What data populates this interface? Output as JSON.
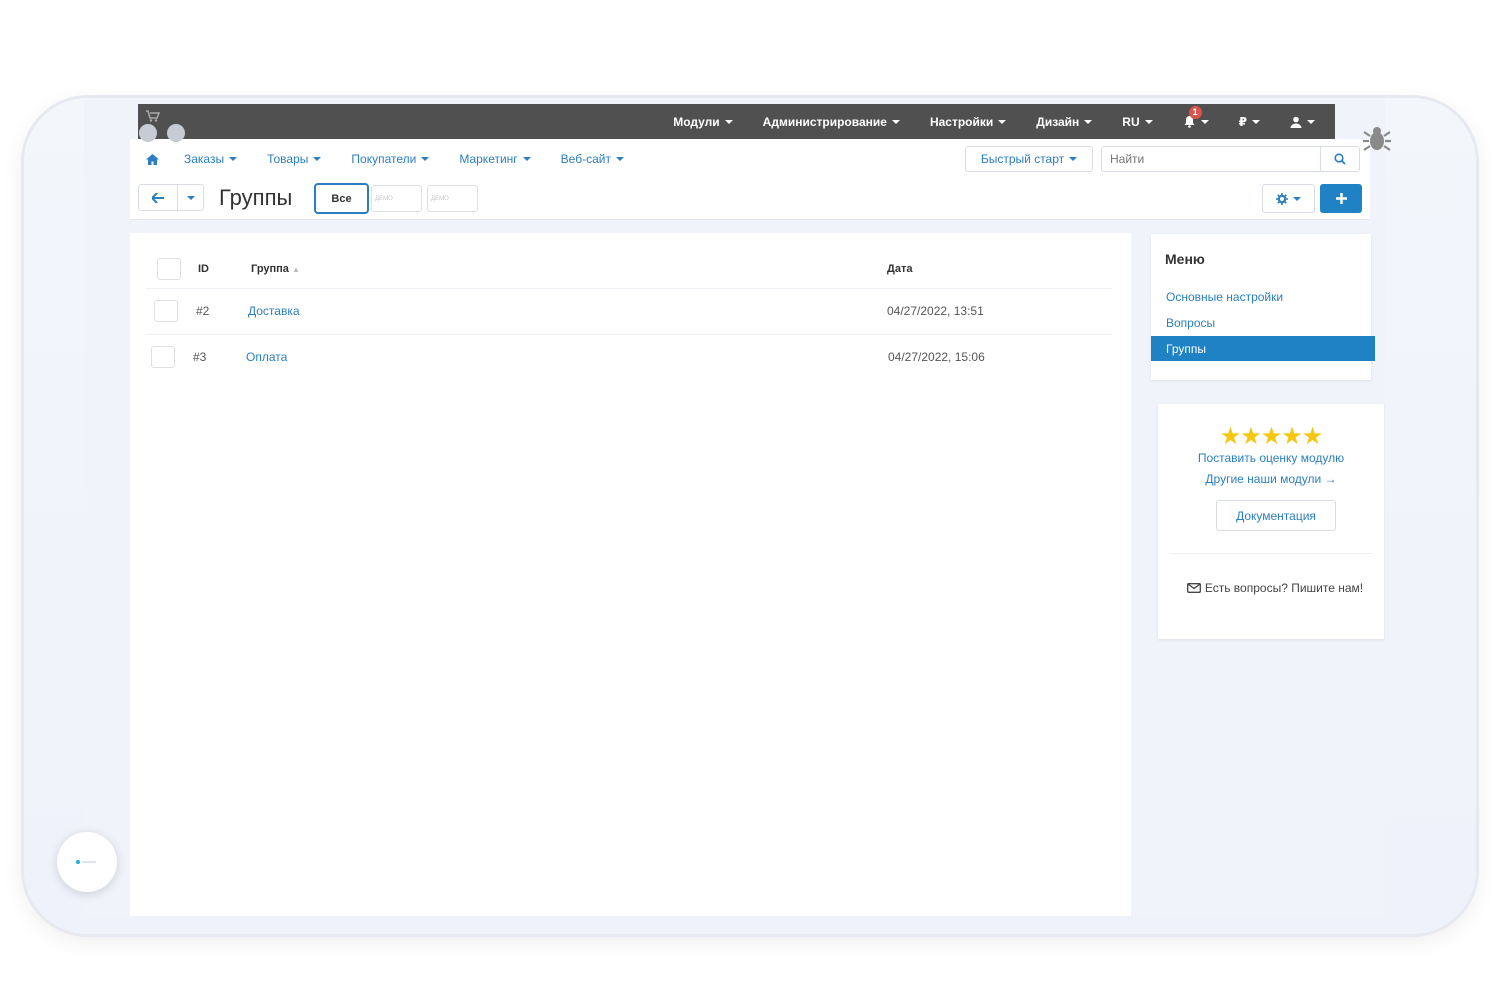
{
  "topbar": {
    "items": [
      {
        "label": "Модули"
      },
      {
        "label": "Администрирование"
      },
      {
        "label": "Настройки"
      },
      {
        "label": "Дизайн"
      },
      {
        "label": "RU"
      },
      {
        "label": ""
      },
      {
        "label": "₽"
      },
      {
        "label": ""
      }
    ],
    "notifications_count": "1"
  },
  "nav": {
    "items": [
      "Заказы",
      "Товары",
      "Покупатели",
      "Маркетинг",
      "Веб-сайт"
    ],
    "quick_start": "Быстрый старт",
    "search_placeholder": "Найти"
  },
  "toolbar": {
    "title": "Группы",
    "filter_all": "Все",
    "demo_label": "ДЕМО"
  },
  "table": {
    "headers": {
      "id": "ID",
      "group": "Группа",
      "date": "Дата"
    },
    "rows": [
      {
        "id": "#2",
        "group": "Доставка",
        "date": "04/27/2022, 13:51"
      },
      {
        "id": "#3",
        "group": "Оплата",
        "date": "04/27/2022, 15:06"
      }
    ]
  },
  "side_menu": {
    "title": "Меню",
    "items": [
      "Основные настройки",
      "Вопросы",
      "Группы"
    ],
    "active_index": 2
  },
  "rating": {
    "stars": "★★★★★",
    "rate_link": "Поставить оценку модулю",
    "other_link": "Другие наши модули →",
    "doc_button": "Документация",
    "contact": "Есть вопросы? Пишите нам!"
  },
  "colors": {
    "accent": "#1e82c4",
    "link": "#2b7fc1",
    "topbar": "#505050",
    "star": "#f6c613"
  }
}
